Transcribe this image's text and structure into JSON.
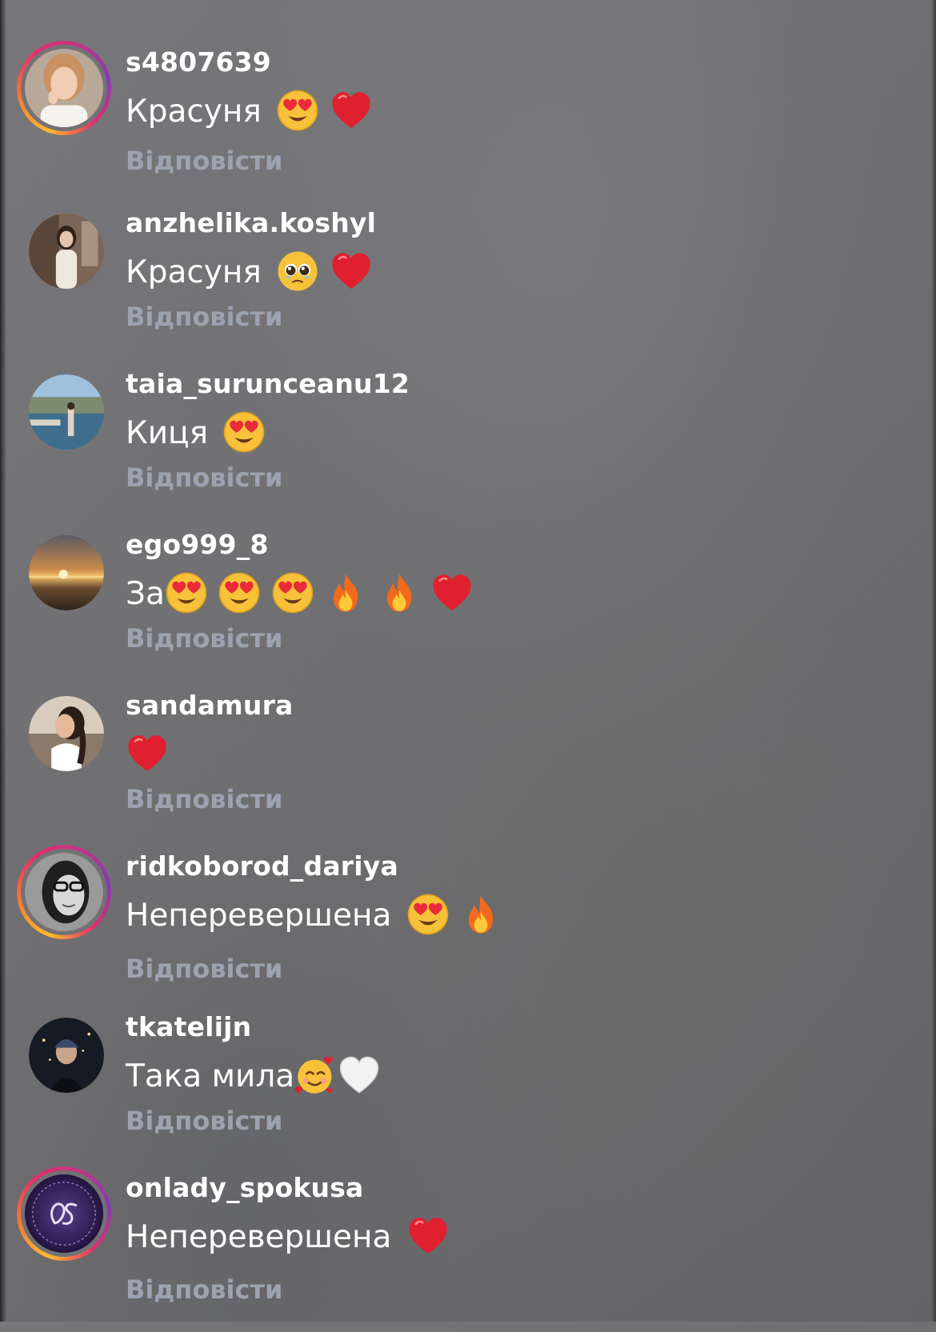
{
  "comments": [
    {
      "username": "s4807639",
      "text": "Красуня",
      "emojis": [
        "heart-eyes-emoji",
        "red-heart-emoji"
      ],
      "reply": "Відповісти",
      "story_ring": true
    },
    {
      "username": "anzhelika.koshyl",
      "text": "Красуня",
      "emojis": [
        "pleading-face-emoji",
        "red-heart-emoji"
      ],
      "reply": "Відповісти",
      "story_ring": false
    },
    {
      "username": "taia_surunceanu12",
      "text": "Киця",
      "emojis": [
        "heart-eyes-emoji"
      ],
      "reply": "Відповісти",
      "story_ring": false
    },
    {
      "username": "ego999_8",
      "text": "За",
      "emojis": [
        "heart-eyes-emoji",
        "heart-eyes-emoji",
        "heart-eyes-emoji",
        "fire-emoji",
        "fire-emoji",
        "red-heart-emoji"
      ],
      "reply": "Відповісти",
      "story_ring": false
    },
    {
      "username": "sandamura",
      "text": "",
      "emojis": [
        "red-heart-emoji"
      ],
      "reply": "Відповісти",
      "story_ring": false
    },
    {
      "username": "ridkoborod_dariya",
      "text": "Неперевершена",
      "emojis": [
        "heart-eyes-emoji",
        "fire-emoji"
      ],
      "reply": "Відповісти",
      "story_ring": true
    },
    {
      "username": "tkatelijn",
      "text": "Така мила",
      "emojis": [
        "smiling-face-with-hearts-emoji",
        "white-heart-emoji"
      ],
      "reply": "Відповісти",
      "story_ring": false
    },
    {
      "username": "onlady_spokusa",
      "text": "Неперевершена",
      "emojis": [
        "red-heart-emoji"
      ],
      "reply": "Відповісти",
      "story_ring": true
    }
  ],
  "colors": {
    "username": "#ffffff",
    "comment_text": "#ffffff",
    "reply_link": "#9da2b0",
    "background": "#707073"
  }
}
